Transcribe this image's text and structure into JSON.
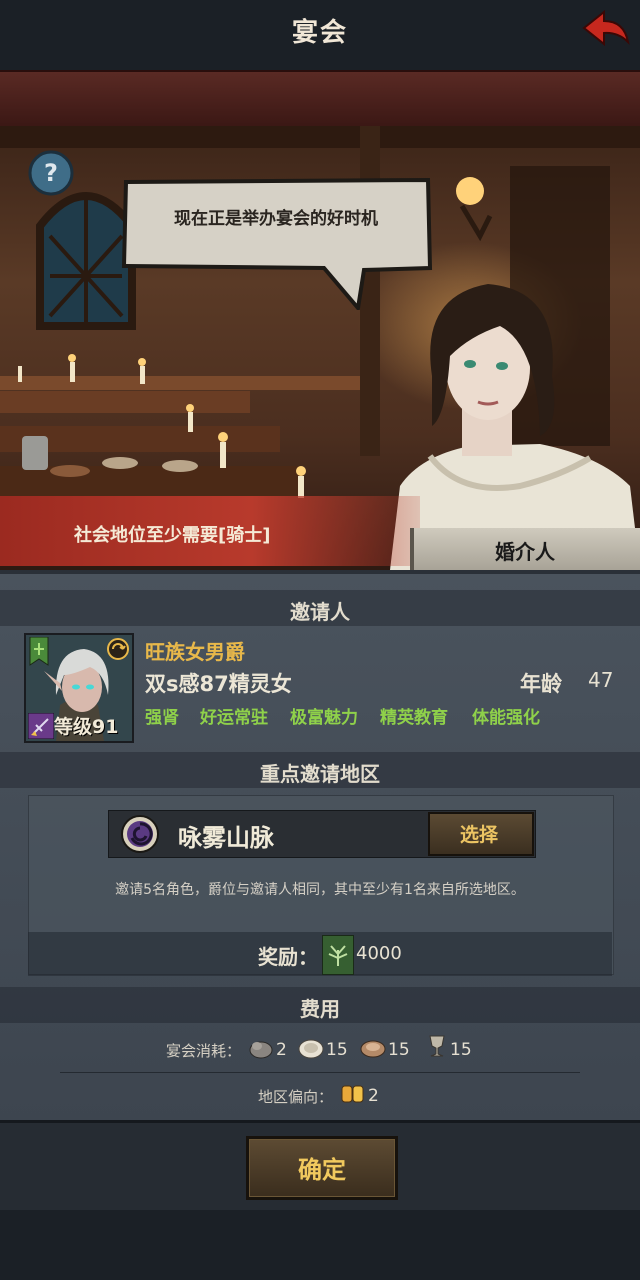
{
  "header": {
    "title": "宴会"
  },
  "scene": {
    "speech": "现在正是举办宴会的好时机",
    "requirement": "社会地位至少需要[骑士]",
    "npc_label": "婚介人"
  },
  "inviter": {
    "section_title": "邀请人",
    "title": "旺族女男爵",
    "race": "双s感87精灵女",
    "age_label": "年龄",
    "age": "47",
    "level_text": "等级91",
    "traits": [
      "强肾",
      "好运常驻",
      "极富魅力",
      "精英教育",
      "体能强化"
    ]
  },
  "region": {
    "section_title": "重点邀请地区",
    "name": "咏雾山脉",
    "select_label": "选择",
    "description": "邀请5名角色，爵位与邀请人相同，其中至少有1名来自所选地区。",
    "reward_label": "奖励：",
    "reward_value": "4000"
  },
  "cost": {
    "section_title": "费用",
    "feast_label": "宴会消耗：",
    "items": [
      {
        "icon": "stone-icon",
        "value": "2"
      },
      {
        "icon": "bread-icon",
        "value": "15"
      },
      {
        "icon": "meat-icon",
        "value": "15"
      },
      {
        "icon": "goblet-icon",
        "value": "15"
      }
    ],
    "region_label": "地区偏向：",
    "region_value": "2"
  },
  "confirm_label": "确定",
  "colors": {
    "header": "#4a2220",
    "accent_gold": "#e8b84a",
    "trait_green": "#8fd14a",
    "requirement_red": "#b83a2c"
  }
}
